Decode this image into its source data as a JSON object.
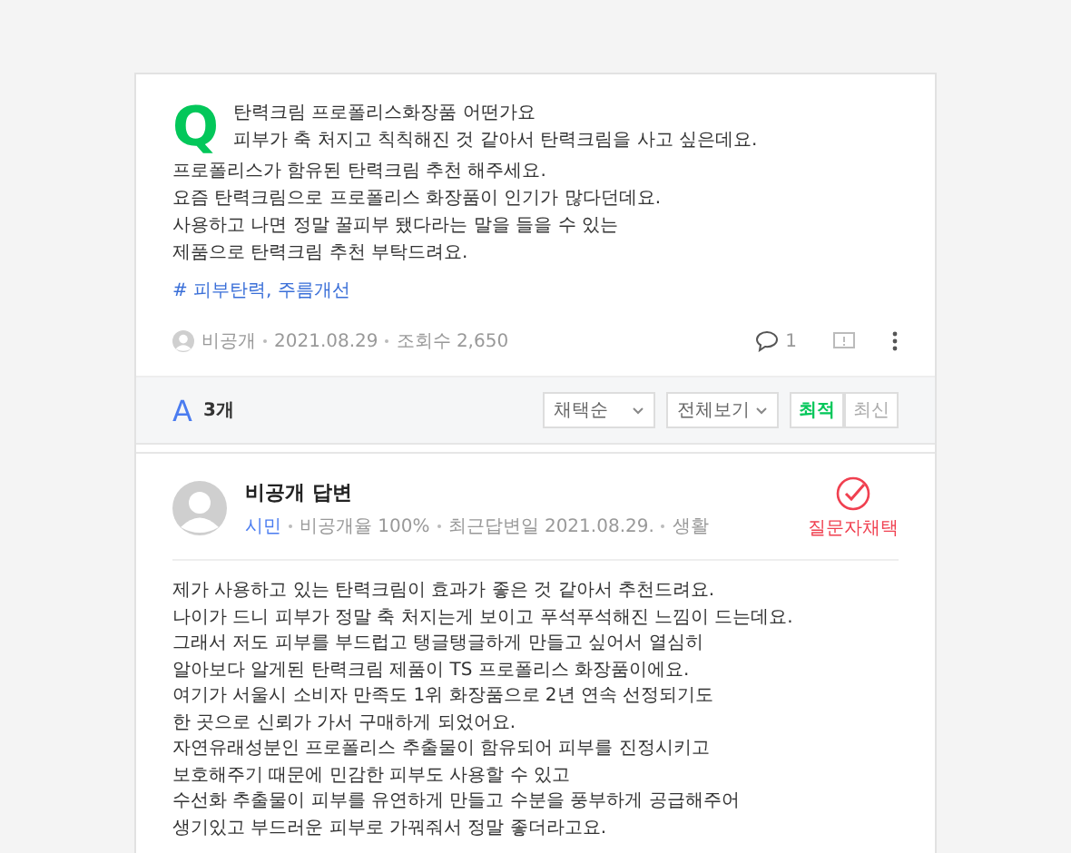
{
  "question": {
    "mark": "Q",
    "title": "탄력크림 프로폴리스화장품 어떤가요",
    "lines": [
      "피부가 축 처지고 칙칙해진 것 같아서 탄력크림을 사고 싶은데요.",
      "프로폴리스가 함유된 탄력크림 추천 해주세요.",
      "요즘 탄력크림으로 프로폴리스 화장품이 인기가 많다던데요.",
      "사용하고 나면 정말 꿀피부 됐다라는 말을 들을 수 있는",
      "제품으로 탄력크림 추천 부탁드려요."
    ],
    "tag": "# 피부탄력, 주름개선",
    "meta": [
      "비공개",
      "2021.08.29",
      "조회수 2,650"
    ],
    "comments": "1"
  },
  "answers_bar": {
    "mark": "A",
    "count": "3개",
    "selects": [
      "채택순",
      "전체보기"
    ],
    "sort_tabs": [
      {
        "label": "최적",
        "selected": true
      },
      {
        "label": "최신",
        "selected": false
      }
    ]
  },
  "answer": {
    "title": "비공개 답변",
    "grade": "시민",
    "meta": [
      "비공개율 100%",
      "최근답변일 2021.08.29.",
      "생활"
    ],
    "badge": "질문자채택",
    "lines": [
      "제가 사용하고 있는 탄력크림이 효과가 좋은 것 같아서 추천드려요.",
      "나이가 드니 피부가 정말 축 처지는게 보이고 푸석푸석해진 느낌이 드는데요.",
      "그래서 저도 피부를 부드럽고 탱글탱글하게 만들고 싶어서 열심히",
      "알아보다 알게된 탄력크림 제품이 TS 프로폴리스 화장품이에요.",
      "여기가 서울시 소비자 만족도 1위 화장품으로 2년 연속 선정되기도",
      "한 곳으로 신뢰가 가서 구매하게 되었어요.",
      "자연유래성분인 프로폴리스 추출물이 함유되어 피부를 진정시키고",
      "보호해주기 때문에 민감한 피부도 사용할 수 있고",
      "수선화 추출물이 피부를 유연하게 만들고 수분을 풍부하게 공급해주어",
      "생기있고 부드러운 피부로 가꿔줘서 정말 좋더라고요."
    ]
  }
}
